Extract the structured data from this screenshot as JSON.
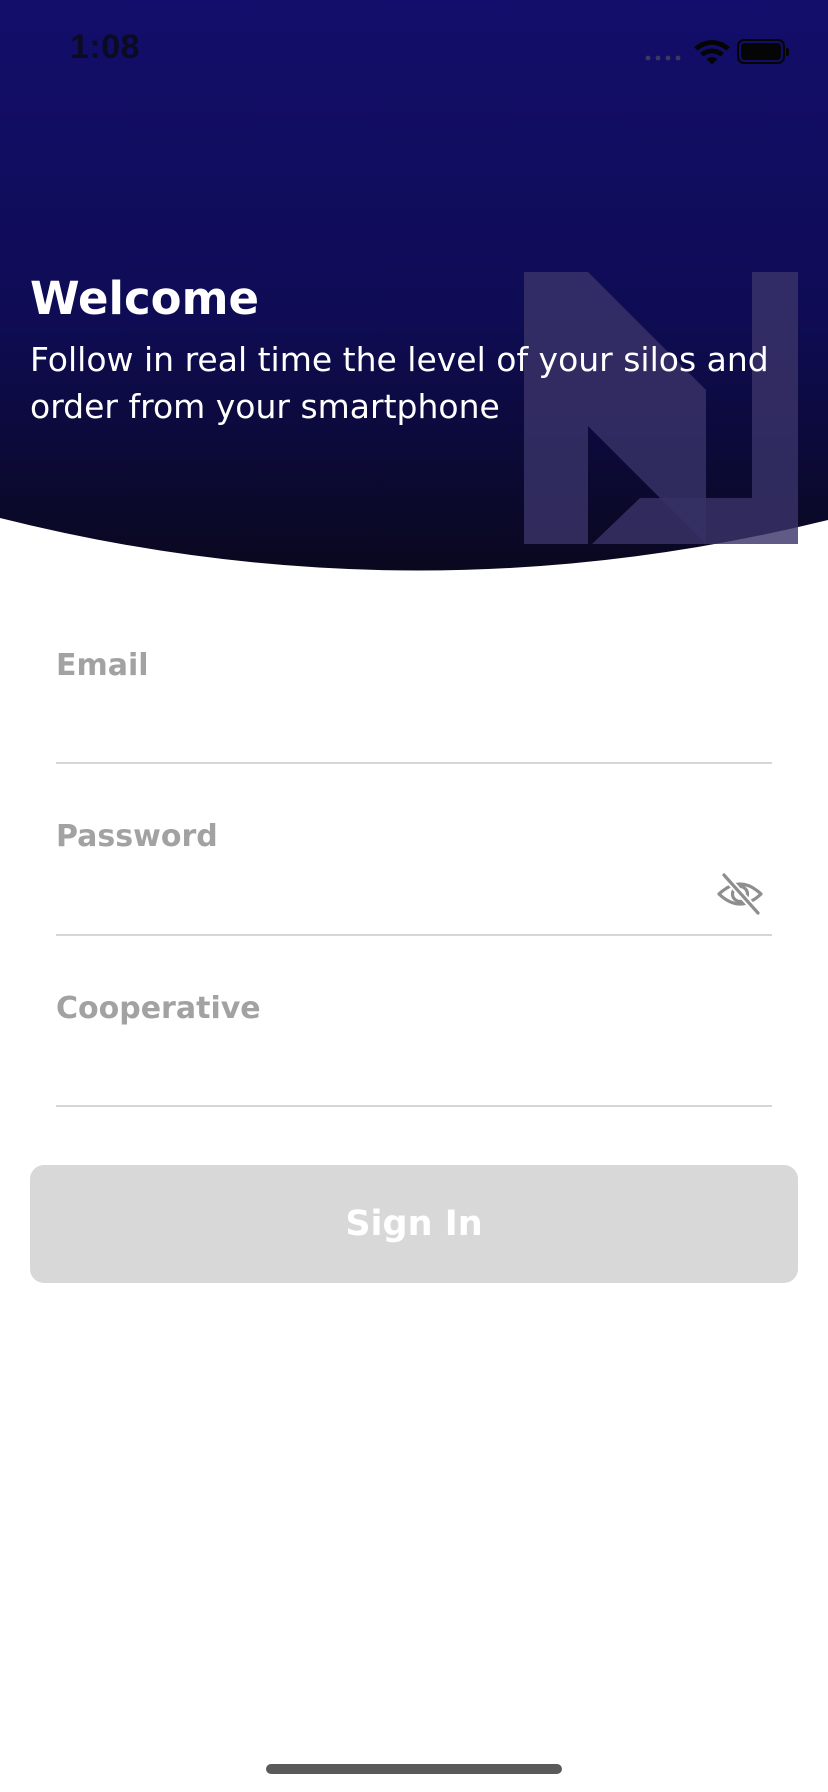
{
  "status_bar": {
    "time": "1:08",
    "icons": [
      "signal-icon",
      "wifi-icon",
      "battery-icon"
    ]
  },
  "header": {
    "title": "Welcome",
    "subtitle": "Follow in real time the level of your silos and order from your smartphone",
    "logo": "brand-logo",
    "colors": {
      "gradient_top": "#130e6b",
      "gradient_bottom": "#09081e",
      "logo_overlay": "#3d3770"
    }
  },
  "form": {
    "email": {
      "label": "Email",
      "value": ""
    },
    "password": {
      "label": "Password",
      "value": "",
      "toggle_icon": "eye-off-icon"
    },
    "cooperative": {
      "label": "Cooperative",
      "value": ""
    },
    "submit": {
      "label": "Sign In",
      "state": "disabled"
    }
  },
  "colors": {
    "label": "#a2a2a2",
    "divider": "#d6d6d6",
    "button_disabled": "#d8d8d8",
    "button_text": "#ffffff"
  }
}
